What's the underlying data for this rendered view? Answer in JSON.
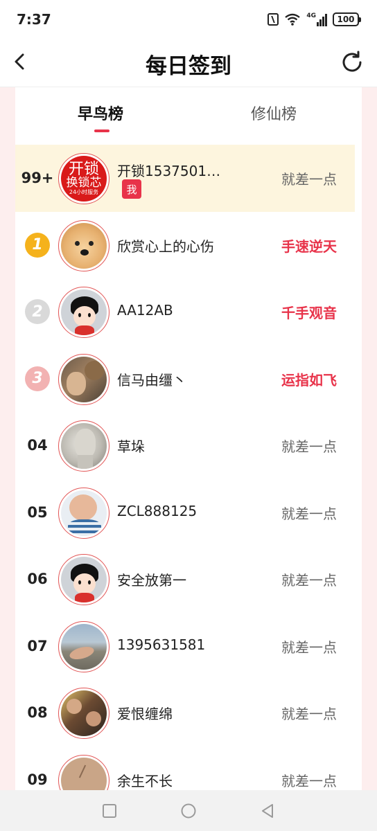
{
  "status_bar": {
    "time": "7:37",
    "network": "4G",
    "battery": "100"
  },
  "header": {
    "title": "每日签到",
    "back_icon": "chevron-left-icon",
    "refresh_icon": "refresh-icon"
  },
  "tabs": [
    {
      "label": "早鸟榜",
      "active": true
    },
    {
      "label": "修仙榜",
      "active": false
    }
  ],
  "colors": {
    "accent": "#e8334a",
    "me_row_bg": "#fdf5de",
    "side_bg": "#fdeeee"
  },
  "rows": [
    {
      "rank": "99+",
      "name": "开锁1537501…",
      "badge": "我",
      "status": "就差一点",
      "hot": false,
      "avatar": "avatar-locksmith"
    },
    {
      "rank": "1",
      "name": "欣赏心上的心伤",
      "status": "手速逆天",
      "hot": true,
      "avatar": "avatar-dog"
    },
    {
      "rank": "2",
      "name": "AA12AB",
      "status": "千手观音",
      "hot": true,
      "avatar": "avatar-cartoon"
    },
    {
      "rank": "3",
      "name": "信马由缰丶",
      "status": "运指如飞",
      "hot": true,
      "avatar": "avatar-man-bear"
    },
    {
      "rank": "04",
      "name": "草垛",
      "status": "就差一点",
      "hot": false,
      "avatar": "avatar-statue"
    },
    {
      "rank": "05",
      "name": "ZCL888125",
      "status": "就差一点",
      "hot": false,
      "avatar": "avatar-baby"
    },
    {
      "rank": "06",
      "name": "安全放第一",
      "status": "就差一点",
      "hot": false,
      "avatar": "avatar-cartoon"
    },
    {
      "rank": "07",
      "name": "1395631581",
      "status": "就差一点",
      "hot": false,
      "avatar": "avatar-beach"
    },
    {
      "rank": "08",
      "name": "爱恨缠绵",
      "status": "就差一点",
      "hot": false,
      "avatar": "avatar-couple"
    },
    {
      "rank": "09",
      "name": "余生不长",
      "status": "就差一点",
      "hot": false,
      "avatar": "avatar-sketch"
    }
  ],
  "locksmith_avatar_text": {
    "line1": "开锁",
    "line2": "换锁芯",
    "line3": "24小时服务"
  },
  "nav_bar": {
    "buttons": [
      "square-icon",
      "circle-icon",
      "triangle-back-icon"
    ]
  }
}
